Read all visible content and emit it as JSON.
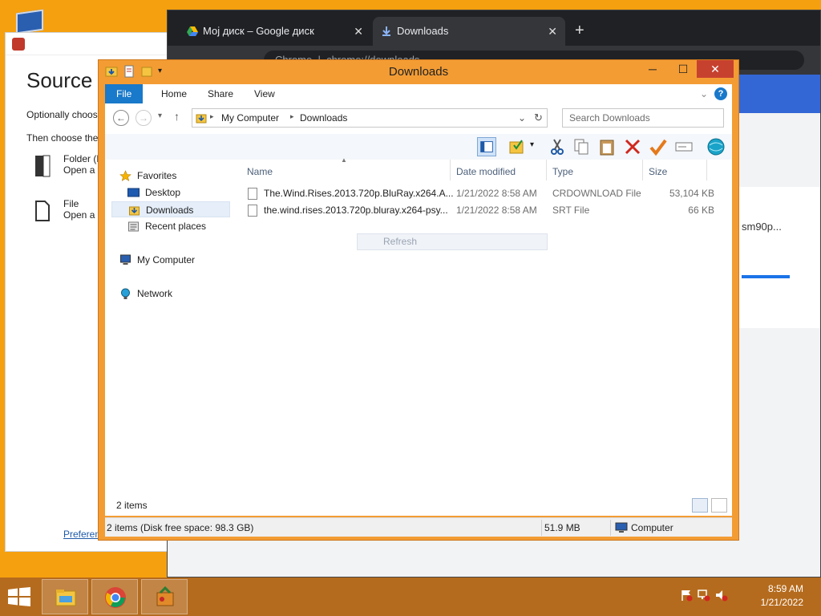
{
  "source_window": {
    "title": "Source S",
    "line1": "Optionally choose",
    "line2": "Then choose the v",
    "options": [
      {
        "title": "Folder (B",
        "desc": "Open a f"
      },
      {
        "title": "File",
        "desc": "Open a s"
      }
    ],
    "preferences_link": "Preferen"
  },
  "chrome": {
    "tabs": [
      {
        "title": "Мој диск – Google диск"
      },
      {
        "title": "Downloads"
      }
    ],
    "url": "chrome://downloads",
    "url_scheme": "Chrome",
    "card_filename": "sm90p..."
  },
  "explorer": {
    "title": "Downloads",
    "ribbon_tabs": [
      "File",
      "Home",
      "Share",
      "View"
    ],
    "address": {
      "root": "My Computer",
      "folder": "Downloads"
    },
    "search_placeholder": "Search Downloads",
    "nav": {
      "favorites": "Favorites",
      "desktop": "Desktop",
      "downloads": "Downloads",
      "recent": "Recent places",
      "computer": "My Computer",
      "network": "Network"
    },
    "columns": {
      "name": "Name",
      "date": "Date modified",
      "type": "Type",
      "size": "Size"
    },
    "files": [
      {
        "name": "The.Wind.Rises.2013.720p.BluRay.x264.A...",
        "date": "1/21/2022 8:58 AM",
        "type": "CRDOWNLOAD File",
        "size": "53,104 KB"
      },
      {
        "name": "the.wind.rises.2013.720p.bluray.x264-psy...",
        "date": "1/21/2022 8:58 AM",
        "type": "SRT File",
        "size": "66 KB"
      }
    ],
    "refresh_label": "Refresh",
    "items_count": "2 items",
    "status": {
      "left": "2 items (Disk free space: 98.3 GB)",
      "size": "51.9 MB",
      "location": "Computer"
    }
  },
  "taskbar": {
    "time": "8:59 AM",
    "date": "1/21/2022"
  }
}
